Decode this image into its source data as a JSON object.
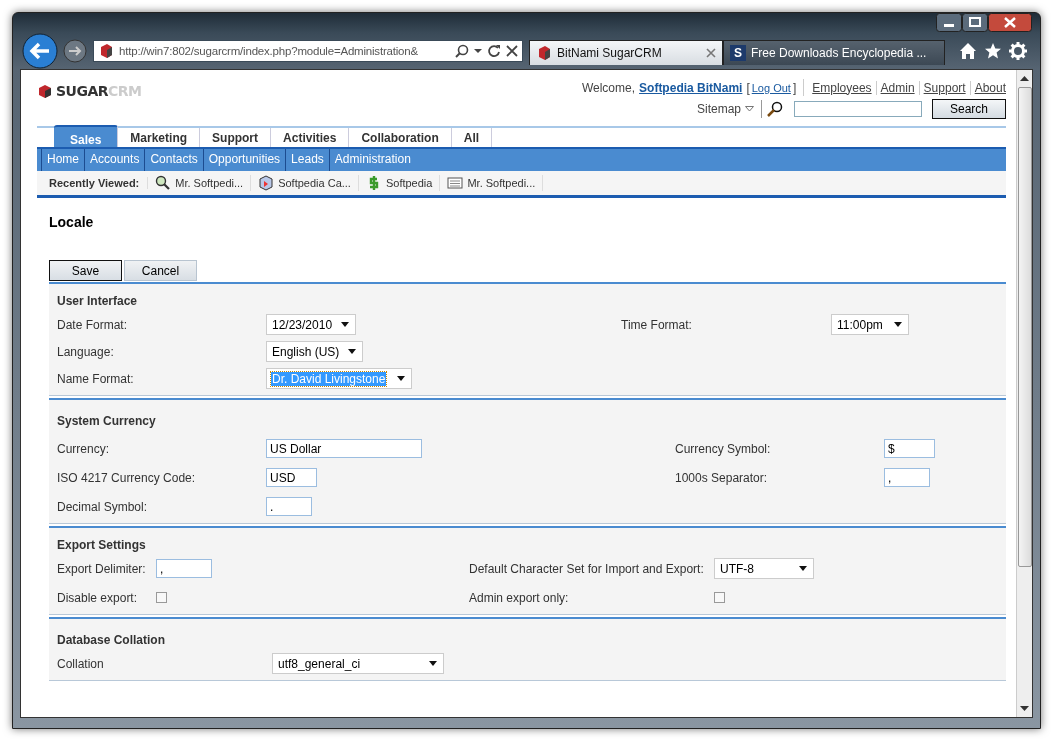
{
  "browser": {
    "address": "http://win7:802/sugarcrm/index.php?module=Administration&",
    "tabs": [
      {
        "label": "BitNami SugarCRM",
        "selected": true,
        "kind": "sugar"
      },
      {
        "label": "Free Downloads Encyclopedia ...",
        "selected": false,
        "kind": "letter"
      }
    ],
    "tab_icon_letter": "S"
  },
  "header": {
    "logo": {
      "primary": "SUGAR",
      "secondary": "CRM"
    },
    "welcome": "Welcome,",
    "user": "Softpedia BitNami",
    "bracket_open": "[",
    "logout": "Log Out",
    "bracket_close": "]",
    "links": [
      "Employees",
      "Admin",
      "Support",
      "About"
    ],
    "sitemap": "Sitemap",
    "search_button": "Search"
  },
  "module_tabs": [
    {
      "label": "Sales",
      "selected": true
    },
    {
      "label": "Marketing",
      "selected": false
    },
    {
      "label": "Support",
      "selected": false
    },
    {
      "label": "Activities",
      "selected": false
    },
    {
      "label": "Collaboration",
      "selected": false
    },
    {
      "label": "All",
      "selected": false
    }
  ],
  "sub_tabs": [
    "Home",
    "Accounts",
    "Contacts",
    "Opportunities",
    "Leads",
    "Administration"
  ],
  "recently_viewed": {
    "label": "Recently Viewed:",
    "items": [
      {
        "label": "Mr. Softpedi...",
        "kind": "contact"
      },
      {
        "label": "Softpedia Ca...",
        "kind": "campaign"
      },
      {
        "label": "Softpedia",
        "kind": "opportunity"
      },
      {
        "label": "Mr. Softpedi...",
        "kind": "note"
      }
    ]
  },
  "page_title": "Locale",
  "buttons": [
    {
      "label": "Save",
      "focused": true
    },
    {
      "label": "Cancel",
      "focused": false
    }
  ],
  "sections": [
    {
      "title": "User Interface",
      "rows": [
        {
          "fields": [
            {
              "label": "Date Format:",
              "kind": "select",
              "value": "12/23/2010",
              "focused": false
            },
            {
              "label": "Time Format:",
              "kind": "select",
              "value": "11:00pm",
              "focused": false
            }
          ]
        },
        {
          "fields": [
            {
              "label": "Language:",
              "kind": "select",
              "value": "English (US)",
              "focused": false
            }
          ]
        },
        {
          "fields": [
            {
              "label": "Name Format:",
              "kind": "select",
              "value": "Dr. David Livingstone",
              "focused": true
            }
          ]
        }
      ]
    },
    {
      "title": "System Currency",
      "rows": [
        {
          "fields": [
            {
              "label": "Currency:",
              "kind": "text",
              "value": "US Dollar"
            },
            {
              "label": "Currency Symbol:",
              "kind": "text",
              "value": "$"
            }
          ]
        },
        {
          "fields": [
            {
              "label": "ISO 4217 Currency Code:",
              "kind": "text",
              "value": "USD"
            },
            {
              "label": "1000s Separator:",
              "kind": "text",
              "value": ","
            }
          ]
        },
        {
          "fields": [
            {
              "label": "Decimal Symbol:",
              "kind": "text",
              "value": "."
            }
          ]
        }
      ]
    },
    {
      "title": "Export Settings",
      "rows": [
        {
          "fields": [
            {
              "label": "Export Delimiter:",
              "kind": "text",
              "value": ","
            },
            {
              "label": "Default Character Set for Import and Export:",
              "kind": "select",
              "value": "UTF-8",
              "focused": false
            }
          ]
        },
        {
          "fields": [
            {
              "label": "Disable export:",
              "kind": "checkbox",
              "checked": false
            },
            {
              "label": "Admin export only:",
              "kind": "checkbox",
              "checked": false
            }
          ]
        }
      ]
    },
    {
      "title": "Database Collation",
      "rows": [
        {
          "fields": [
            {
              "label": "Collation",
              "kind": "select",
              "value": "utf8_general_ci",
              "focused": false
            }
          ]
        }
      ]
    }
  ]
}
